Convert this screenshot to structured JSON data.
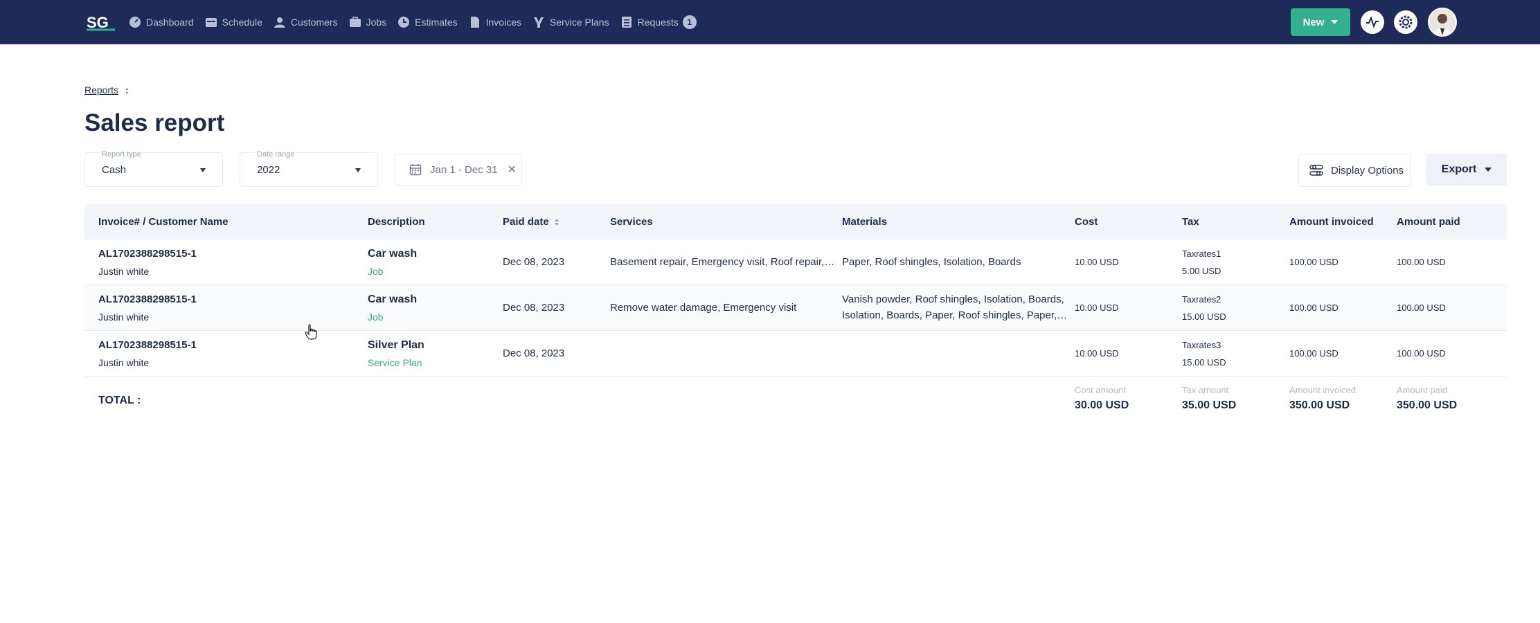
{
  "nav": {
    "items": [
      {
        "label": "Dashboard",
        "icon": "dashboard-icon"
      },
      {
        "label": "Schedule",
        "icon": "calendar-icon"
      },
      {
        "label": "Customers",
        "icon": "user-icon"
      },
      {
        "label": "Jobs",
        "icon": "briefcase-icon"
      },
      {
        "label": "Estimates",
        "icon": "estimate-icon"
      },
      {
        "label": "Invoices",
        "icon": "file-icon"
      },
      {
        "label": "Service Plans",
        "icon": "plan-icon"
      },
      {
        "label": "Requests",
        "icon": "list-icon",
        "badge": "1"
      }
    ],
    "new_label": "New"
  },
  "breadcrumb": {
    "reports": "Reports",
    "sep": ":"
  },
  "title": "Sales report",
  "filters": {
    "report_type": {
      "label": "Report type",
      "value": "Cash"
    },
    "date_range": {
      "label": "Date range",
      "value": "2022"
    },
    "dates": "Jan 1 - Dec 31",
    "clear": "✕",
    "display_options": "Display Options",
    "export": "Export"
  },
  "table": {
    "headers": {
      "invoice": "Invoice# / Customer Name",
      "description": "Description",
      "paid_date": "Paid date",
      "services": "Services",
      "materials": "Materials",
      "cost": "Cost",
      "tax": "Tax",
      "amount_invoiced": "Amount invoiced",
      "amount_paid": "Amount paid"
    },
    "rows": [
      {
        "invoice": "AL1702388298515-1",
        "customer": "Justin white",
        "description": "Car wash",
        "type": "Job",
        "paid_date": "Dec 08, 2023",
        "services": "Basement repair, Emergency visit, Roof repair,…",
        "materials_1": "Paper, Roof shingles, Isolation, Boards",
        "materials_2": "",
        "cost": "10.00 USD",
        "tax_name": "Taxrates1",
        "tax_value": "5.00 USD",
        "amount_invoiced": "100.00 USD",
        "amount_paid": "100.00 USD"
      },
      {
        "invoice": "AL1702388298515-1",
        "customer": "Justin white",
        "description": "Car wash",
        "type": "Job",
        "paid_date": "Dec 08, 2023",
        "services": "Remove water damage, Emergency visit",
        "materials_1": "Vanish powder, Roof shingles, Isolation, Boards,",
        "materials_2": "Isolation, Boards, Paper, Roof shingles, Paper,…",
        "cost": "10.00 USD",
        "tax_name": "Taxrates2",
        "tax_value": "15.00 USD",
        "amount_invoiced": "100.00 USD",
        "amount_paid": "100.00 USD"
      },
      {
        "invoice": "AL1702388298515-1",
        "customer": "Justin white",
        "description": "Silver Plan",
        "type": "Service Plan",
        "paid_date": "Dec 08, 2023",
        "services": "",
        "materials_1": "",
        "materials_2": "",
        "cost": "10.00 USD",
        "tax_name": "Taxrates3",
        "tax_value": "15.00 USD",
        "amount_invoiced": "100.00 USD",
        "amount_paid": "100.00 USD"
      }
    ],
    "total": {
      "label": "TOTAL :",
      "cost_label": "Cost amount",
      "cost": "30.00 USD",
      "tax_label": "Tax amount",
      "tax": "35.00 USD",
      "invoiced_label": "Amount invoiced",
      "invoiced": "350.00 USD",
      "paid_label": "Amount paid",
      "paid": "350.00 USD"
    }
  },
  "colors": {
    "nav_bg": "#1e2b58",
    "accent": "#35b08f",
    "link_green": "#35a985"
  }
}
